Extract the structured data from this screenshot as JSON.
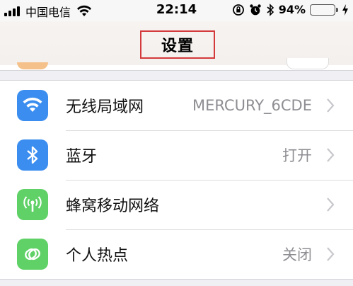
{
  "status_bar": {
    "carrier": "中国电信",
    "time": "22:14",
    "battery_percent": "94%",
    "battery_level": 0.94,
    "icons": [
      "signal-icon",
      "wifi-icon",
      "rotation-lock-icon",
      "alarm-icon",
      "bluetooth-icon",
      "battery-icon",
      "charging-icon"
    ]
  },
  "nav": {
    "title": "设置"
  },
  "colors": {
    "wifi": "#3b8ef0",
    "bluetooth": "#3b8ef0",
    "cellular": "#5fd166",
    "hotspot": "#5fd166",
    "highlight": "#d4393c"
  },
  "settings": {
    "items": [
      {
        "label": "无线局域网",
        "value": "MERCURY_6CDE",
        "icon": "wifi-icon"
      },
      {
        "label": "蓝牙",
        "value": "打开",
        "icon": "bluetooth-icon"
      },
      {
        "label": "蜂窝移动网络",
        "value": "",
        "icon": "cellular-icon"
      },
      {
        "label": "个人热点",
        "value": "关闭",
        "icon": "hotspot-icon"
      }
    ]
  }
}
